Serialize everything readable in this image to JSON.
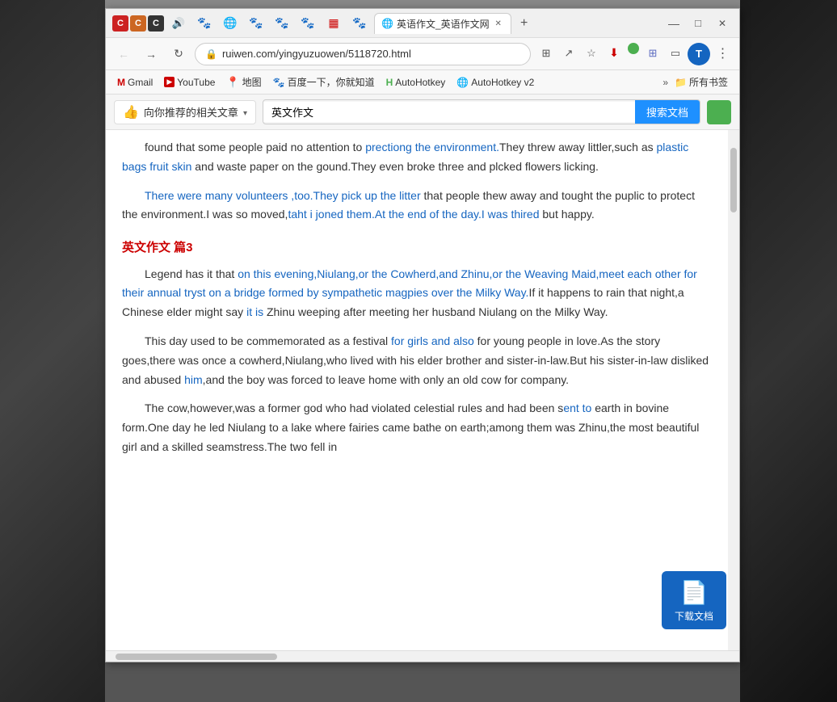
{
  "window": {
    "title": "英语作文_英语作文网",
    "url": "ruiwen.com/yingyuzuowen/5118720.html"
  },
  "titlebar": {
    "crimson_icons": [
      "C",
      "C",
      "C"
    ],
    "tabs": [
      {
        "label": "英语作文_英语作文网",
        "active": true
      }
    ],
    "new_tab_label": "+",
    "controls": {
      "minimize": "—",
      "maximize": "□",
      "close": "✕"
    }
  },
  "addressbar": {
    "back_label": "←",
    "forward_label": "→",
    "refresh_label": "↻",
    "lock_icon": "🔒",
    "url": "ruiwen.com/yingyuzuowen/5118720.html",
    "profile_label": "T"
  },
  "bookmarks": [
    {
      "label": "Gmail",
      "icon": "M"
    },
    {
      "label": "YouTube",
      "icon": "▶"
    },
    {
      "label": "地图",
      "icon": "📍"
    },
    {
      "label": "百度一下，你就知道",
      "icon": "百"
    },
    {
      "label": "AutoHotkey",
      "icon": "H"
    },
    {
      "label": "AutoHotkey v2",
      "icon": "🌐"
    }
  ],
  "toolbar": {
    "recommend_label": "向你推荐的相关文章",
    "search_placeholder": "英文作文",
    "search_btn_label": "搜索文档"
  },
  "content": {
    "paragraphs": [
      {
        "id": "p1",
        "text": "found that some people paid no attention to prectiong the environment.They threw away littler,such as plastic bags fruit skin and waste paper on the gound.They even broke three and plcked flowers licking."
      },
      {
        "id": "p2",
        "text": "There were many volunteers ,too.They pick up the litter that people thew away and tought the puplic to protect the environment.I was so moved,taht i joned them.At the end of the day.I was thired but happy."
      },
      {
        "id": "section3_title",
        "text": "英文作文 篇3"
      },
      {
        "id": "p3",
        "text": "Legend has it that on this evening,Niulang,or the Cowherd,and Zhinu,or the Weaving Maid,meet each other for their annual tryst on a bridge formed by sympathetic magpies over the Milky Way.If it happens to rain that night,a Chinese elder might say it is Zhinu weeping after meeting her husband Niulang on the Milky Way."
      },
      {
        "id": "p4",
        "text": "This day used to be commemorated as a festival for girls and also for young people in love.As the story goes,there was once a cowherd,Niulang,who lived with his elder brother and sister-in-law.But his sister-in-law disliked and abused him,and the boy was forced to leave home with only an old cow for company."
      },
      {
        "id": "p5",
        "text": "The cow,however,was a former god who had violated celestial rules and had been sent to earth in bovine form.One day he led Niulang to a lake where fairies came bathe on earth;among them was Zhinu,the most beautiful girl and a skilled seamstress.The two fell in"
      }
    ],
    "download_btn_label": "下载文档"
  }
}
